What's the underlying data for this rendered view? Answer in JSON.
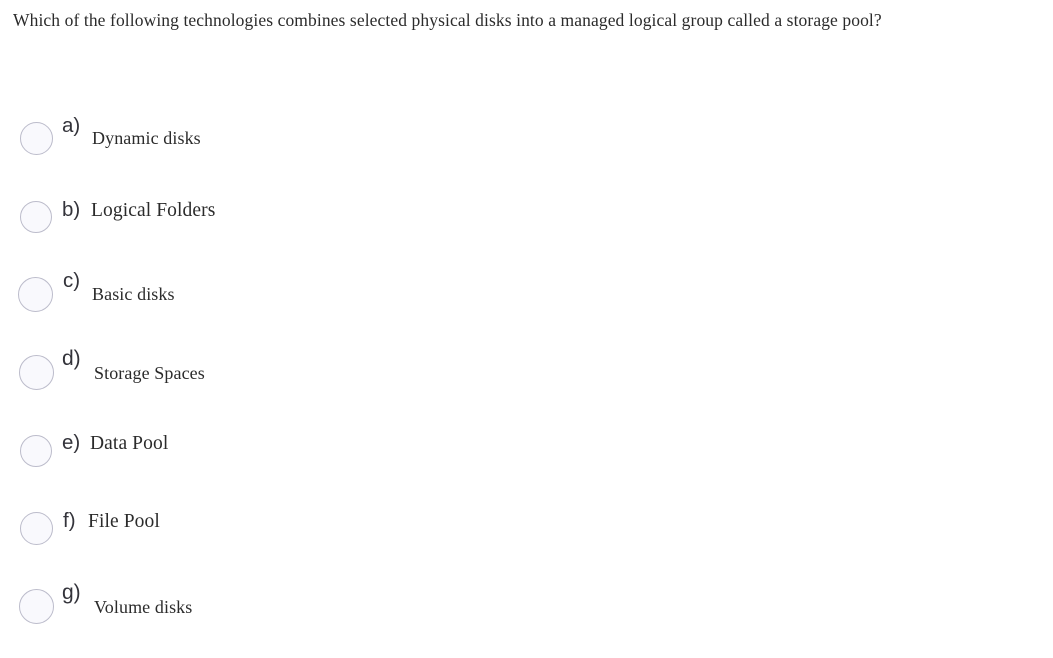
{
  "question": {
    "text": "Which of the following technologies combines selected physical disks into a managed logical group called a storage pool?"
  },
  "colors": {
    "background": "#ffffff",
    "text": "#2b2b2b",
    "radio_fill": "#f9f9fd",
    "radio_border": "#bcbccb"
  },
  "options": [
    {
      "letter": "a)",
      "label": "Dynamic disks",
      "selected": false
    },
    {
      "letter": "b)",
      "label": "Logical Folders",
      "selected": false
    },
    {
      "letter": "c)",
      "label": "Basic disks",
      "selected": false
    },
    {
      "letter": "d)",
      "label": "Storage Spaces",
      "selected": false
    },
    {
      "letter": "e)",
      "label": "Data Pool",
      "selected": false
    },
    {
      "letter": "f)",
      "label": "File Pool",
      "selected": false
    },
    {
      "letter": "g)",
      "label": "Volume disks",
      "selected": false
    }
  ]
}
